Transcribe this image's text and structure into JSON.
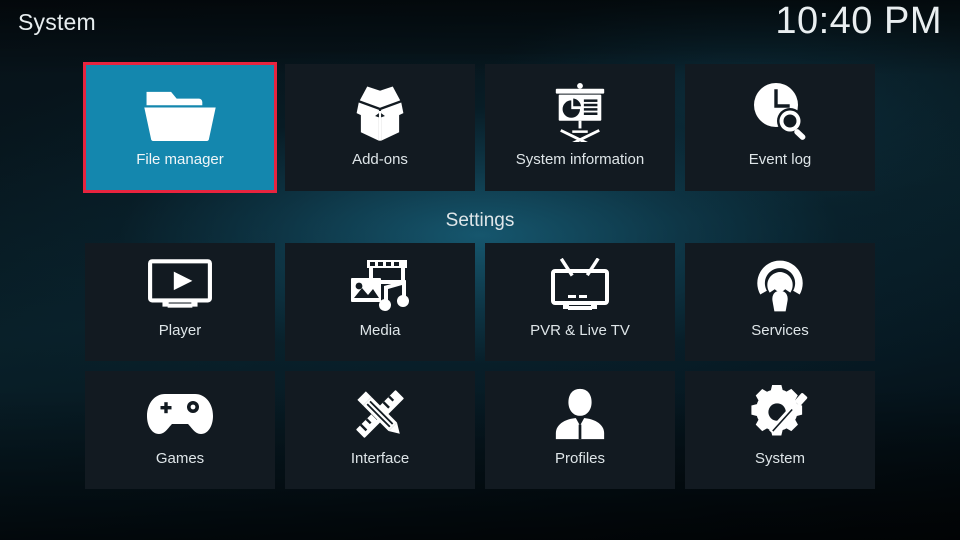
{
  "header": {
    "title": "System",
    "clock": "10:40 PM"
  },
  "section": {
    "settings_label": "Settings"
  },
  "colors": {
    "selected_tile": "#1487ae",
    "selection_border": "#e8243f",
    "tile_background": "#121a21",
    "label_text": "#dee5e8",
    "background_glow": "#18607a"
  },
  "top_row": {
    "items": [
      {
        "label": "File manager",
        "icon": "folder-icon",
        "selected": true
      },
      {
        "label": "Add-ons",
        "icon": "open-box-icon",
        "selected": false
      },
      {
        "label": "System information",
        "icon": "presentation-chart-icon",
        "selected": false
      },
      {
        "label": "Event log",
        "icon": "clock-search-icon",
        "selected": false
      }
    ]
  },
  "settings_grid": {
    "row_one": [
      {
        "label": "Player",
        "icon": "monitor-play-icon",
        "selected": false
      },
      {
        "label": "Media",
        "icon": "film-photo-music-icon",
        "selected": false
      },
      {
        "label": "PVR & Live TV",
        "icon": "tv-antenna-icon",
        "selected": false
      },
      {
        "label": "Services",
        "icon": "broadcast-person-icon",
        "selected": false
      }
    ],
    "row_two": [
      {
        "label": "Games",
        "icon": "gamepad-icon",
        "selected": false
      },
      {
        "label": "Interface",
        "icon": "pencil-ruler-icon",
        "selected": false
      },
      {
        "label": "Profiles",
        "icon": "person-icon",
        "selected": false
      },
      {
        "label": "System",
        "icon": "gear-screwdriver-icon",
        "selected": false
      }
    ]
  }
}
